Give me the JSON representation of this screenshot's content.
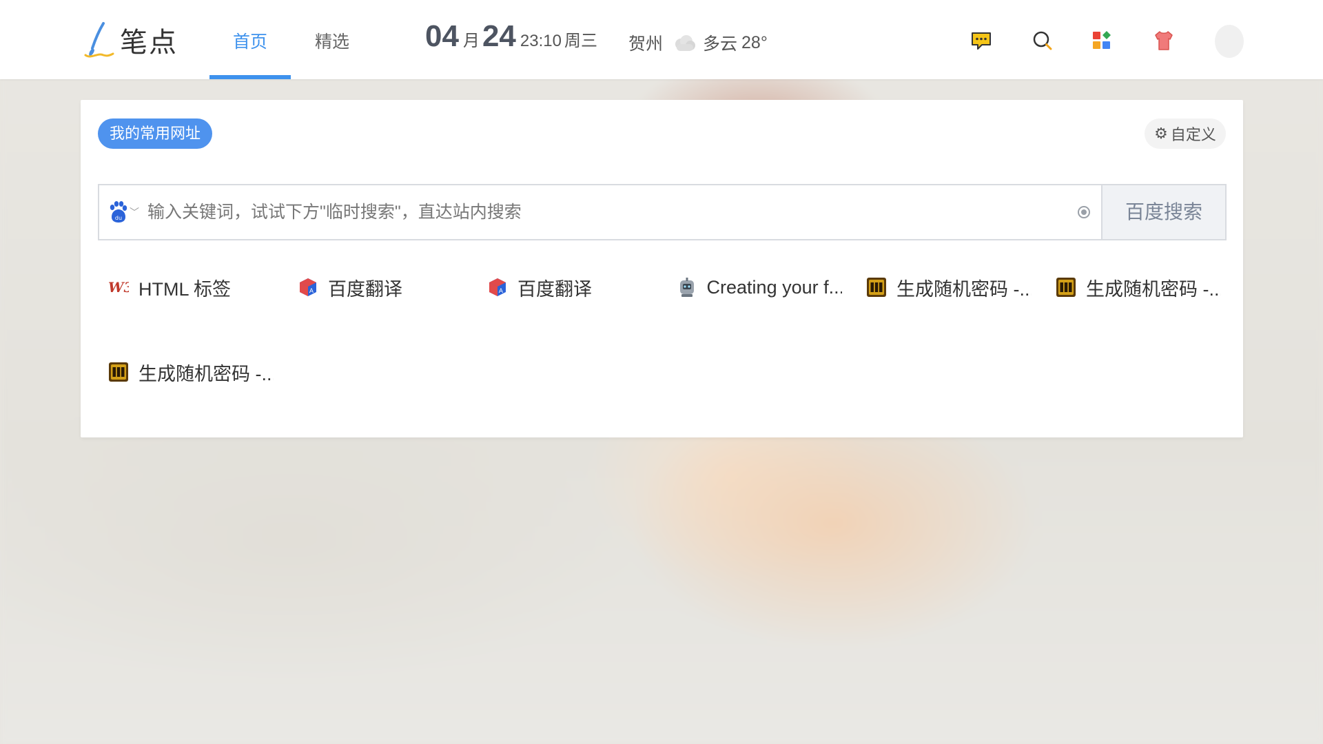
{
  "header": {
    "logo_text": "笔点",
    "tabs": [
      {
        "label": "首页",
        "active": true
      },
      {
        "label": "精选",
        "active": false
      }
    ],
    "date": {
      "month": "04",
      "month_unit": "月",
      "day": "24",
      "time": "23:10",
      "weekday": "周三"
    },
    "weather": {
      "city": "贺州",
      "condition": "多云",
      "temperature": "28°",
      "icon": "cloud-icon"
    },
    "icons": [
      "message-icon",
      "search-icon",
      "apps-icon",
      "skin-icon"
    ],
    "accent_color": "#3e92ed"
  },
  "card": {
    "pill_label": "我的常用网址",
    "customize_label": "自定义",
    "search": {
      "engine_icon": "baidu-paw-icon",
      "placeholder": "输入关键词，试试下方\"临时搜索\"，直达站内搜索",
      "button_label": "百度搜索"
    },
    "sites": [
      {
        "label": "HTML 标签",
        "icon": "w3-icon"
      },
      {
        "label": "百度翻译",
        "icon": "translate-icon"
      },
      {
        "label": "百度翻译",
        "icon": "translate-icon"
      },
      {
        "label": "Creating your f...",
        "icon": "robot-icon"
      },
      {
        "label": "生成随机密码 -...",
        "icon": "slot-machine-icon"
      },
      {
        "label": "生成随机密码 -...",
        "icon": "slot-machine-icon"
      },
      {
        "label": "生成随机密码 -...",
        "icon": "slot-machine-icon"
      }
    ]
  }
}
